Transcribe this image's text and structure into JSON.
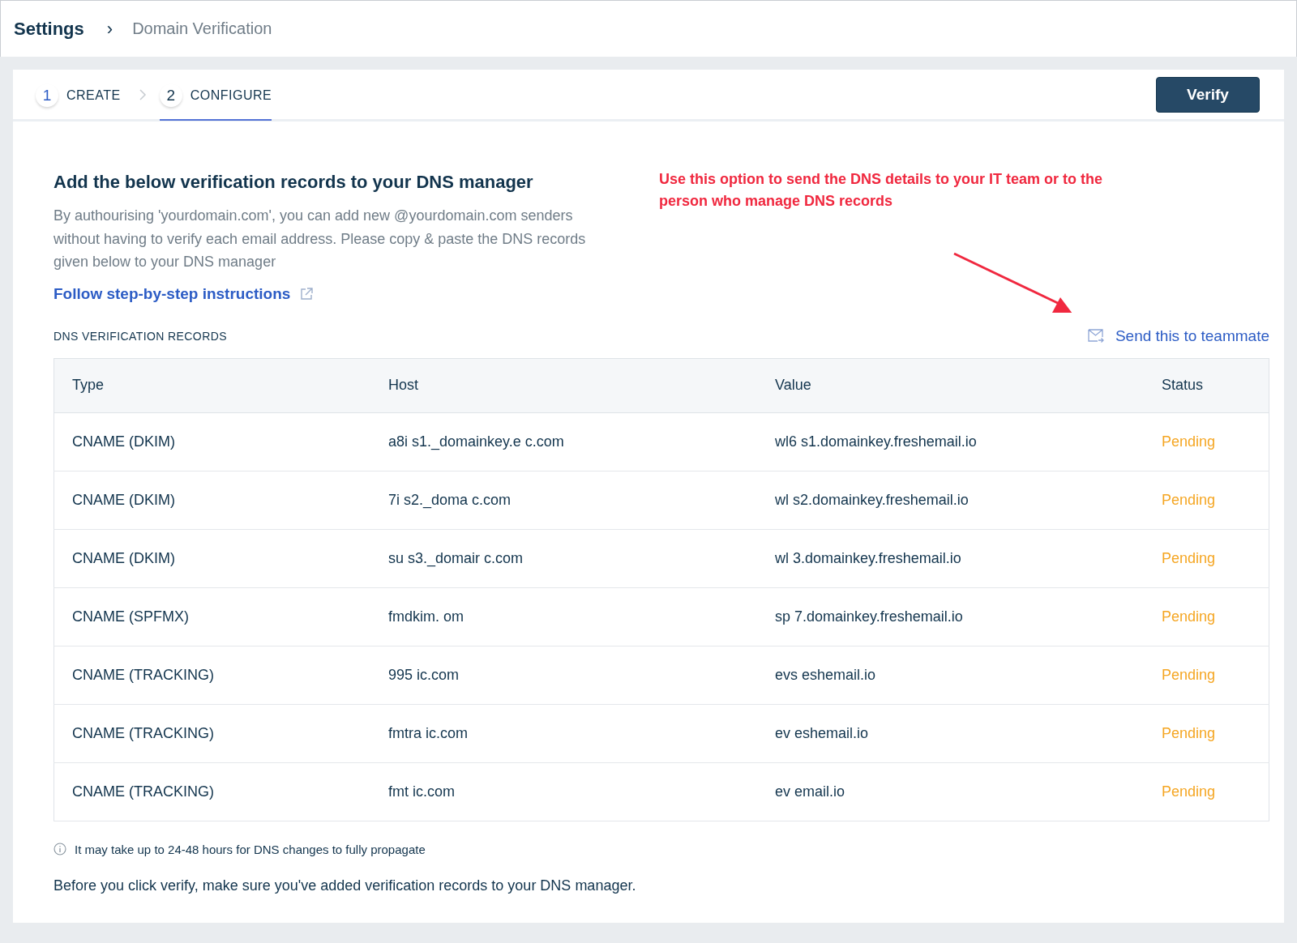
{
  "breadcrumb": {
    "root": "Settings",
    "separator": "›",
    "current": "Domain Verification"
  },
  "steps": [
    {
      "number": "1",
      "label": "CREATE",
      "selected": false
    },
    {
      "number": "2",
      "label": "CONFIGURE",
      "selected": true
    }
  ],
  "verify_button": "Verify",
  "heading": "Add the below verification records to your DNS manager",
  "description": "By authourising 'yourdomain.com', you can add new @yourdomain.com senders without having to verify each email address. Please copy & paste the DNS records given below to your DNS manager",
  "instructions_link": "Follow step-by-step instructions",
  "annotation": "Use this option to send the DNS details to your IT team or to the person who manage DNS records",
  "section_label": "DNS VERIFICATION RECORDS",
  "send_link": "Send this to teammate",
  "table": {
    "columns": [
      "Type",
      "Host",
      "Value",
      "Status"
    ],
    "rows": [
      {
        "type": "CNAME (DKIM)",
        "host": "a8i s1._domainkey.e c.com",
        "value": "wl6 s1.domainkey.freshemail.io",
        "status": "Pending"
      },
      {
        "type": "CNAME (DKIM)",
        "host": "7i s2._doma c.com",
        "value": "wl s2.domainkey.freshemail.io",
        "status": "Pending"
      },
      {
        "type": "CNAME (DKIM)",
        "host": "su s3._domair c.com",
        "value": "wl 3.domainkey.freshemail.io",
        "status": "Pending"
      },
      {
        "type": "CNAME (SPFMX)",
        "host": "fmdkim. om",
        "value": "sp 7.domainkey.freshemail.io",
        "status": "Pending"
      },
      {
        "type": "CNAME (TRACKING)",
        "host": "995 ic.com",
        "value": "evs eshemail.io",
        "status": "Pending"
      },
      {
        "type": "CNAME (TRACKING)",
        "host": "fmtra ic.com",
        "value": "ev eshemail.io",
        "status": "Pending"
      },
      {
        "type": "CNAME (TRACKING)",
        "host": "fmt ic.com",
        "value": "ev email.io",
        "status": "Pending"
      }
    ]
  },
  "note": "It may take up to 24-48 hours for DNS changes to fully propagate",
  "footer": "Before you click verify, make sure you've added verification records to your DNS manager."
}
